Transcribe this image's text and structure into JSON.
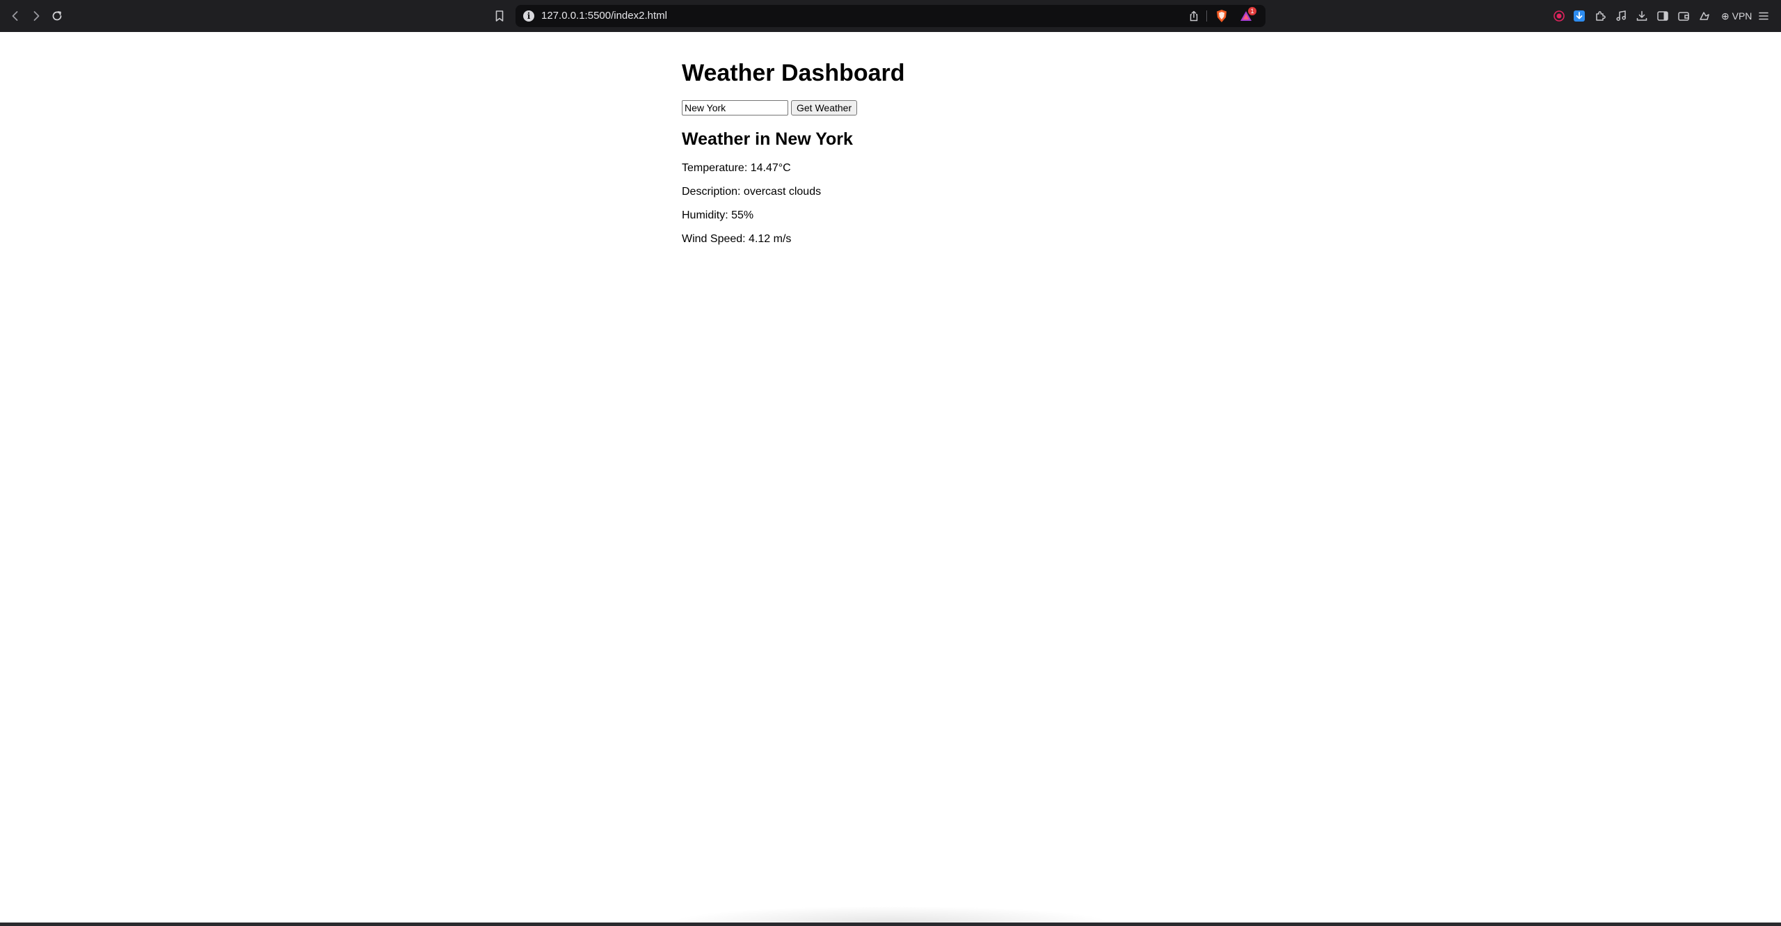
{
  "browser": {
    "url": "127.0.0.1:5500/index2.html",
    "vpn_label": "VPN",
    "rewards_badge": "1",
    "icons": [
      "back-icon",
      "forward-icon",
      "reload-icon",
      "bookmark-icon",
      "site-info-icon",
      "share-icon",
      "brave-shield-icon",
      "brave-rewards-icon",
      "record-icon",
      "download-extension-icon",
      "extensions-icon",
      "media-icon",
      "downloads-icon",
      "sidebar-icon",
      "wallet-icon",
      "leo-icon",
      "vpn-icon",
      "menu-icon"
    ]
  },
  "page": {
    "title": "Weather Dashboard",
    "city_input_value": "New York",
    "button_label": "Get Weather",
    "result_heading": "Weather in New York",
    "temperature": "Temperature: 14.47°C",
    "description": "Description: overcast clouds",
    "humidity": "Humidity: 55%",
    "wind_speed": "Wind Speed: 4.12 m/s"
  },
  "colors": {
    "toolbar_bg": "#1f1f22",
    "urlbar_bg": "#0f0f11",
    "page_bg": "#ffffff",
    "text": "#000000"
  }
}
